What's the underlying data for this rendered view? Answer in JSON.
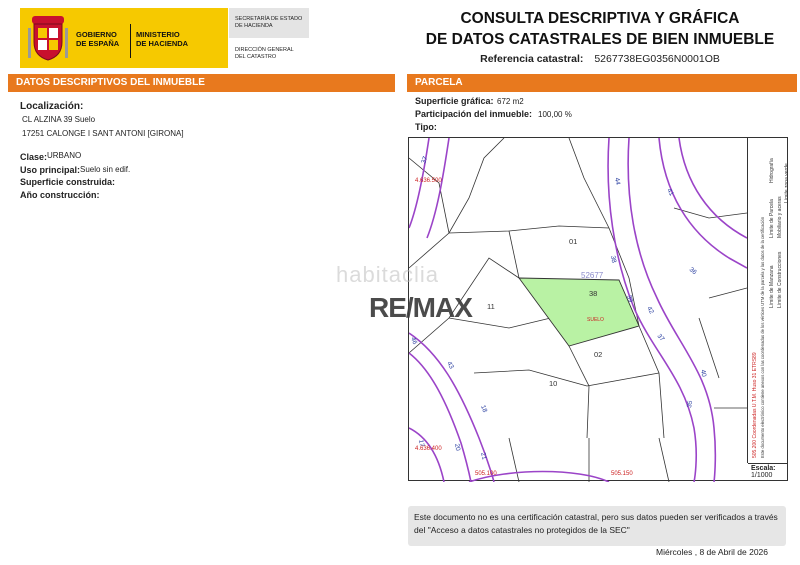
{
  "header": {
    "gov_line1": "GOBIERNO",
    "gov_line2": "DE ESPAÑA",
    "min_line1": "MINISTERIO",
    "min_line2": "DE HACIENDA",
    "sec_line1": "SECRETARÍA DE ESTADO",
    "sec_line2": "DE HACIENDA",
    "dir_line1": "DIRECCIÓN GENERAL",
    "dir_line2": "DEL CATASTRO",
    "title_line1": "CONSULTA DESCRIPTIVA Y GRÁFICA",
    "title_line2": "DE DATOS CATASTRALES DE BIEN INMUEBLE",
    "ref_label": "Referencia catastral:",
    "ref_value": "5267738EG0356N0001OB"
  },
  "left": {
    "section_title": "DATOS DESCRIPTIVOS DEL INMUEBLE",
    "loc_label": "Localización:",
    "loc_line1": "CL ALZINA 39 Suelo",
    "loc_line2": "17251 CALONGE I SANT ANTONI [GIRONA]",
    "clase_label": "Clase:",
    "clase_value": "URBANO",
    "uso_label": "Uso principal:",
    "uso_value": "Suelo sin edif.",
    "sup_label": "Superficie construida:",
    "anio_label": "Año construcción:"
  },
  "right": {
    "section_title": "PARCELA",
    "sup_graf_label": "Superficie gráfica:",
    "sup_graf_value": "672 m2",
    "part_label": "Participación del inmueble:",
    "part_value": "100,00 %",
    "tipo_label": "Tipo:"
  },
  "map": {
    "labels": {
      "p01": "01",
      "p02": "02",
      "p10": "10",
      "p11": "11",
      "p38": "38",
      "block": "52677",
      "suelo": "SUELO",
      "coord_y1": "4.636.500",
      "coord_y2": "4.636.400",
      "coord_x1": "505.100",
      "coord_x2": "505.150",
      "n37": "37",
      "n44": "44",
      "n41": "41",
      "n36": "36",
      "n38": "38",
      "n39": "39",
      "n42": "42",
      "n37b": "37",
      "n40": "40",
      "n35": "35",
      "n43": "43",
      "n18": "18",
      "n17": "17",
      "n20": "20",
      "n21": "21",
      "n46": "46"
    },
    "legend": {
      "l1": "Límite de Manzana",
      "l2": "Límite de Parcela",
      "l3": "Límite de Construcciones",
      "l4": "Mobiliario y aceras",
      "l5": "Límite zona verde",
      "l6": "Hidrografía",
      "crs": "505.200 Coordenadas U.T.M. Huso 31 ETRS89",
      "note": "Este documento electrónico contiene anexos con las coordenadas de los vértices UTM de la parcela y las datos de la certificación"
    },
    "escala_label": "Escala:",
    "escala_value": "1/1000",
    "colors": {
      "parcel_fill": "#b9f2a4",
      "road": "#9b44c8",
      "label_blue": "#2a3fa0",
      "label_red": "#cc2222"
    }
  },
  "watermarks": {
    "habitacia": "habitaclia",
    "remax": "RE/MAX"
  },
  "footer": {
    "note": "Este documento no es una certificación catastral, pero sus datos pueden ser verificados a través del \"Acceso a datos catastrales no protegidos de la SEC\"",
    "date": "Miércoles , 8 de Abril de 2026"
  }
}
